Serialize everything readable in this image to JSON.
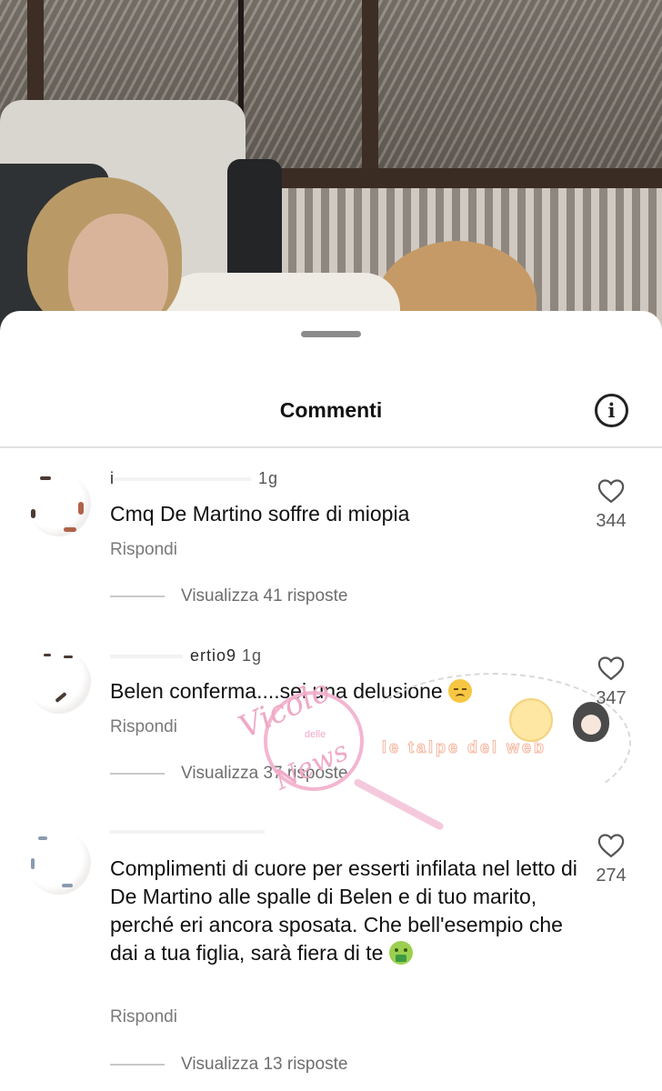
{
  "sheet": {
    "title": "Commenti"
  },
  "comments": [
    {
      "username": "i",
      "time": "1g",
      "text": "Cmq De Martino soffre di miopia",
      "reply": "Rispondi",
      "view_replies": "Visualizza 41 risposte",
      "likes": "344"
    },
    {
      "username": "ertio9",
      "time": "1g",
      "text": "Belen conferma....sei una delusione",
      "emoji": "disappointed-face-emoji",
      "reply": "Rispondi",
      "view_replies": "Visualizza 37 risposte",
      "likes": "347"
    },
    {
      "username": "",
      "time": "",
      "text": "Complimenti di cuore per esserti infilata nel letto di De Martino alle spalle di Belen e di tuo marito, perché eri ancora sposata. Che bell'esempio che dai a tua figlia, sarà fiera di te",
      "emoji": "vomiting-face-emoji",
      "reply": "Rispondi",
      "view_replies": "Visualizza 13 risposte",
      "likes": "274"
    }
  ],
  "watermark": {
    "line1": "Vicolo",
    "line2": "delle",
    "line3": "News",
    "strip": "le talpe del web"
  },
  "colors": {
    "text": "#111111",
    "secondary": "#7a7a7a",
    "divider": "#e0e0e0",
    "watermark_pink": "#f0a9c6"
  }
}
